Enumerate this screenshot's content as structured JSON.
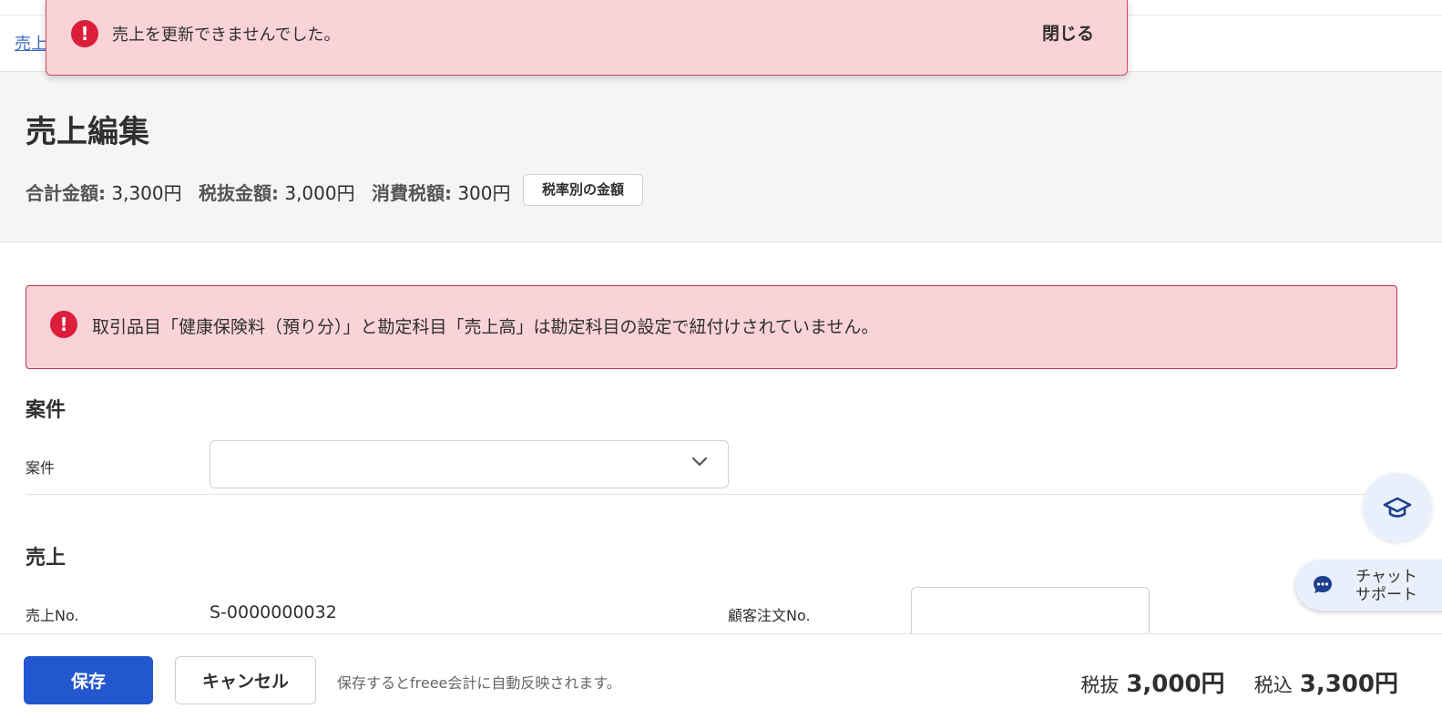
{
  "breadcrumb": {
    "label": "売上"
  },
  "toast": {
    "icon": "!",
    "message": "売上を更新できませんでした。",
    "close_label": "閉じる"
  },
  "page": {
    "title": "売上編集"
  },
  "summary": {
    "total_label": "合計金額:",
    "total_value": "3,300円",
    "excl_label": "税抜金額:",
    "excl_value": "3,000円",
    "tax_label": "消費税額:",
    "tax_value": "300円",
    "rate_button_label": "税率別の金額"
  },
  "alert": {
    "icon": "!",
    "message": "取引品目「健康保険料（預り分）」と勘定科目「売上高」は勘定科目の設定で紐付けされていません。"
  },
  "project_section": {
    "title": "案件",
    "field_label": "案件",
    "select_value": ""
  },
  "sales_section": {
    "title": "売上",
    "sales_no_label": "売上No.",
    "sales_no_value": "S-0000000032",
    "customer_order_label": "顧客注文No.",
    "customer_order_value": ""
  },
  "floating": {
    "learn_icon": "graduation-cap-icon",
    "chat_label_line1": "チャット",
    "chat_label_line2": "サポート"
  },
  "footer": {
    "save_label": "保存",
    "cancel_label": "キャンセル",
    "note": "保存するとfreee会計に自動反映されます。",
    "excl_label": "税抜",
    "excl_value": "3,000円",
    "incl_label": "税込",
    "incl_value": "3,300円"
  },
  "colors": {
    "error_bg": "#f9d3d7",
    "error_icon": "#dc1e3a",
    "primary": "#2357cf"
  }
}
